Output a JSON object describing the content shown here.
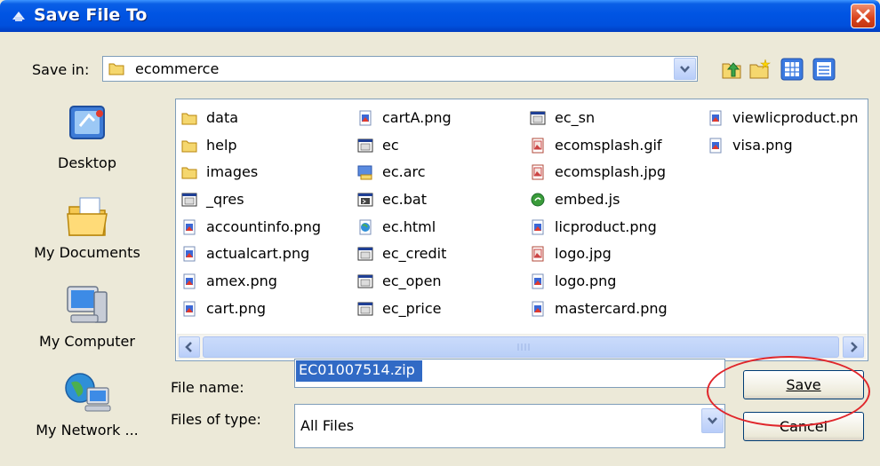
{
  "window": {
    "title": "Save File To"
  },
  "save_in": {
    "label": "Save in:",
    "folder": "ecommerce"
  },
  "toolbar": {
    "buttons": [
      {
        "name": "up-one-level-icon"
      },
      {
        "name": "create-new-folder-icon"
      },
      {
        "name": "thumbnails-view-icon"
      },
      {
        "name": "list-view-menu-icon"
      }
    ]
  },
  "places": [
    {
      "label": "Desktop",
      "icon": "desktop-icon"
    },
    {
      "label": "My Documents",
      "icon": "my-documents-icon"
    },
    {
      "label": "My Computer",
      "icon": "my-computer-icon"
    },
    {
      "label": "My Network ...",
      "icon": "my-network-icon"
    }
  ],
  "files": {
    "columns": [
      [
        {
          "name": "data",
          "icon": "folder-icon"
        },
        {
          "name": "help",
          "icon": "folder-icon"
        },
        {
          "name": "images",
          "icon": "folder-icon"
        },
        {
          "name": "_qres",
          "icon": "executable-icon"
        },
        {
          "name": "accountinfo.png",
          "icon": "png-file-icon"
        },
        {
          "name": "actualcart.png",
          "icon": "png-file-icon"
        },
        {
          "name": "amex.png",
          "icon": "png-file-icon"
        },
        {
          "name": "cart.png",
          "icon": "png-file-icon"
        }
      ],
      [
        {
          "name": "cartA.png",
          "icon": "png-file-icon"
        },
        {
          "name": "ec",
          "icon": "executable-icon"
        },
        {
          "name": "ec.arc",
          "icon": "arc-file-icon"
        },
        {
          "name": "ec.bat",
          "icon": "batch-file-icon"
        },
        {
          "name": "ec.html",
          "icon": "html-file-icon"
        },
        {
          "name": "ec_credit",
          "icon": "executable-icon"
        },
        {
          "name": "ec_open",
          "icon": "executable-icon"
        },
        {
          "name": "ec_price",
          "icon": "executable-icon"
        }
      ],
      [
        {
          "name": "ec_sn",
          "icon": "executable-icon"
        },
        {
          "name": "ecomsplash.gif",
          "icon": "image-file-icon"
        },
        {
          "name": "ecomsplash.jpg",
          "icon": "image-file-icon"
        },
        {
          "name": "embed.js",
          "icon": "script-file-icon"
        },
        {
          "name": "licproduct.png",
          "icon": "png-file-icon"
        },
        {
          "name": "logo.jpg",
          "icon": "image-file-icon"
        },
        {
          "name": "logo.png",
          "icon": "png-file-icon"
        },
        {
          "name": "mastercard.png",
          "icon": "png-file-icon"
        }
      ],
      [
        {
          "name": "viewlicproduct.pn",
          "icon": "png-file-icon"
        },
        {
          "name": "visa.png",
          "icon": "png-file-icon"
        }
      ]
    ]
  },
  "file_name": {
    "label": "File name:",
    "value": "EC01007514.zip"
  },
  "file_type": {
    "label": "Files of type:",
    "value": "All Files"
  },
  "buttons": {
    "save": "Save",
    "cancel": "Cancel"
  },
  "colors": {
    "titlebar": "#0054e3",
    "selection": "#316ac5",
    "highlight_ring": "#e0262b"
  }
}
